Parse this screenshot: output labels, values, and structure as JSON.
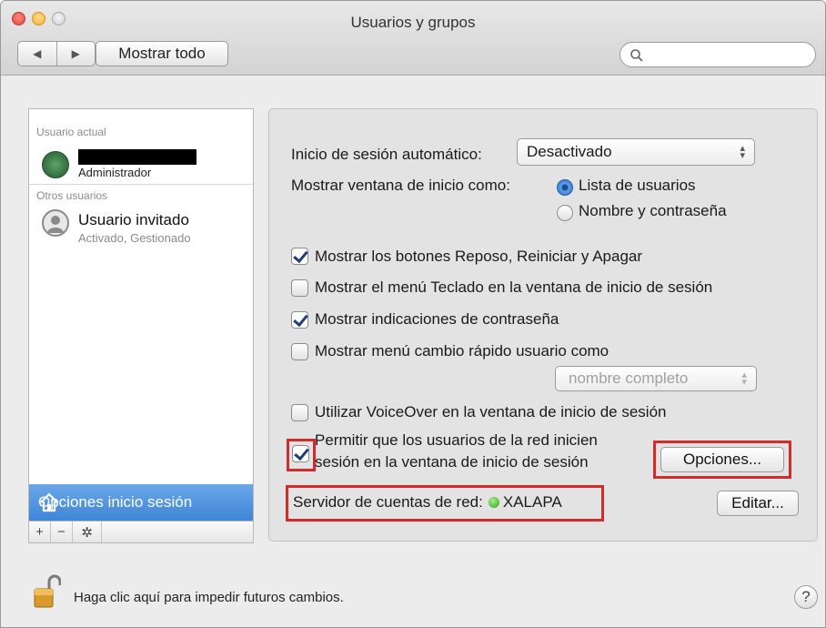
{
  "window": {
    "title": "Usuarios y grupos",
    "show_all_label": "Mostrar todo",
    "nav_back": "◀",
    "nav_forward": "▶",
    "search_placeholder": ""
  },
  "sidebar": {
    "current_user_header": "Usuario actual",
    "current_user": {
      "name": "",
      "role": "Administrador"
    },
    "other_users_header": "Otros usuarios",
    "other_users": [
      {
        "name": "Usuario invitado",
        "status": "Activado, Gestionado"
      }
    ],
    "selected_item": "Opciones inicio sesión",
    "tools": {
      "add": "+",
      "remove": "−",
      "gear": "✲"
    }
  },
  "login_options": {
    "auto_login_label": "Inicio de sesión automático:",
    "auto_login_value": "Desactivado",
    "display_window_label": "Mostrar ventana de inicio como:",
    "display_options": [
      {
        "label": "Lista de usuarios",
        "selected": true
      },
      {
        "label": "Nombre y contraseña",
        "selected": false
      }
    ],
    "checkboxes": [
      {
        "label": "Mostrar los botones Reposo, Reiniciar y Apagar",
        "checked": true
      },
      {
        "label": "Mostrar el menú Teclado en la ventana de inicio de sesión",
        "checked": false
      },
      {
        "label": "Mostrar indicaciones de contraseña",
        "checked": true
      },
      {
        "label": "Mostrar menú cambio rápido usuario como",
        "checked": false
      }
    ],
    "fast_switch_value": "nombre completo",
    "voiceover_label": "Utilizar VoiceOver en la ventana de inicio de sesión",
    "voiceover_checked": false,
    "network_users_label_line1": "Permitir que los usuarios de la red inicien",
    "network_users_label_line2": "sesión en la ventana de inicio de sesión",
    "network_users_checked": true,
    "options_button": "Opciones...",
    "server_label": "Servidor de cuentas de red:",
    "server_name": "XALAPA",
    "server_status_color": "#2da21a",
    "edit_button": "Editar..."
  },
  "footer": {
    "lock_text": "Haga clic aquí para impedir futuros cambios.",
    "help_label": "?"
  },
  "colors": {
    "highlight_box": "#d22b2b",
    "selection_blue": "#4a8fdc"
  }
}
